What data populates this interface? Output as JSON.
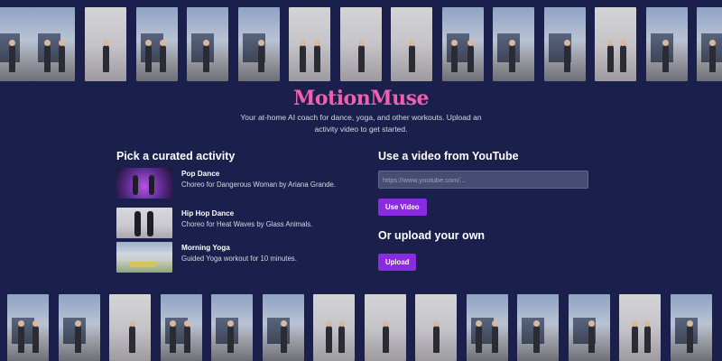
{
  "brand": {
    "title": "MotionMuse",
    "tagline": "Your at-home AI coach for dance, yoga, and other workouts. Upload an activity video to get started.",
    "accent": "#f15fb0"
  },
  "curated": {
    "heading": "Pick a curated activity",
    "items": [
      {
        "name": "Pop Dance",
        "description": "Choreo for Dangerous Woman by Ariana Grande."
      },
      {
        "name": "Hip Hop Dance",
        "description": "Choreo for Heat Waves by Glass Animals."
      },
      {
        "name": "Morning Yoga",
        "description": "Guided Yoga workout for 10 minutes."
      }
    ]
  },
  "youtube": {
    "heading": "Use a video from YouTube",
    "placeholder": "https://www.youtube.com/...",
    "button_label": "Use Video"
  },
  "upload": {
    "heading": "Or upload your own",
    "button_label": "Upload"
  },
  "colors": {
    "background": "#1a1f4b",
    "button": "#8a2be2"
  }
}
